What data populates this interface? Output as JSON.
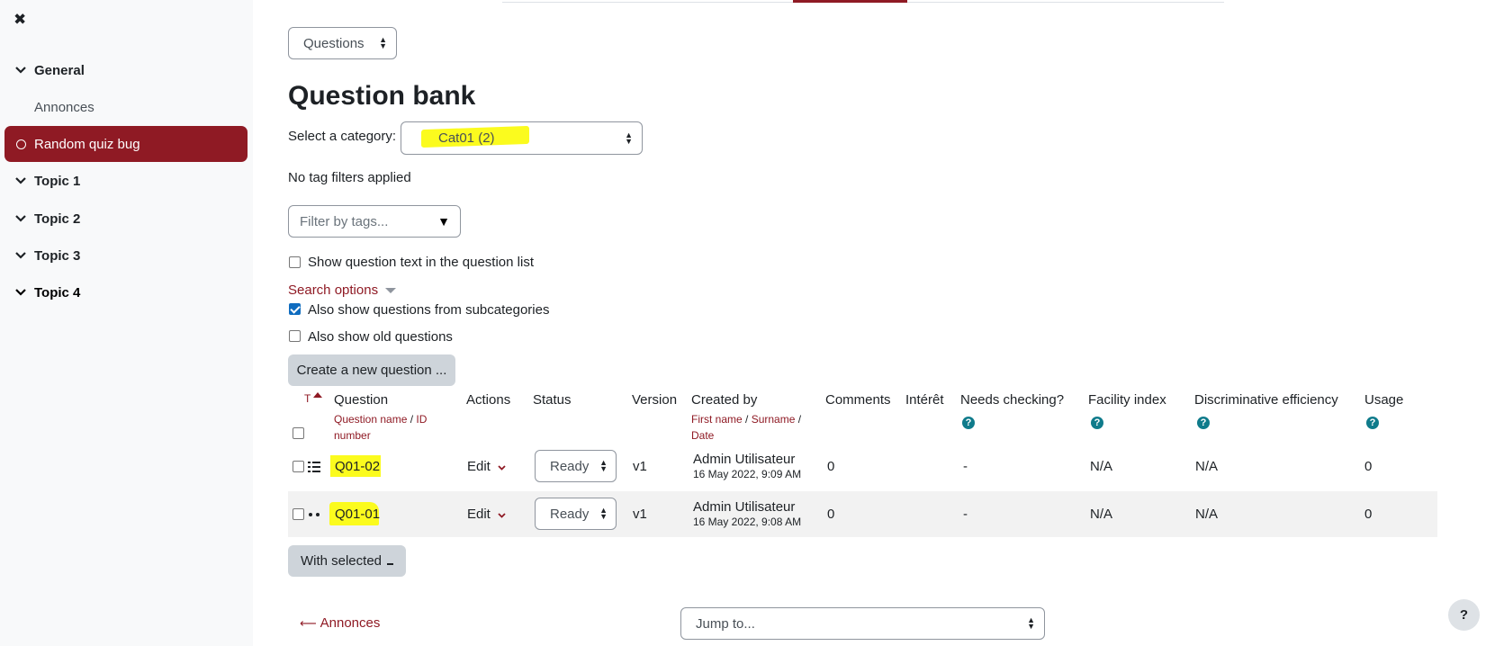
{
  "sidebar": {
    "close_glyph": "✖",
    "items": [
      {
        "label": "General",
        "kind": "section"
      },
      {
        "label": "Annonces",
        "kind": "plain"
      },
      {
        "label": "Random quiz bug",
        "kind": "active"
      },
      {
        "label": "Topic 1",
        "kind": "section"
      },
      {
        "label": "Topic 2",
        "kind": "section"
      },
      {
        "label": "Topic 3",
        "kind": "section"
      },
      {
        "label": "Topic 4",
        "kind": "section"
      }
    ]
  },
  "nav_select": {
    "value": "Questions"
  },
  "page_title": "Question bank",
  "category": {
    "label": "Select a category:",
    "value": "Cat01 (2)"
  },
  "tag_filters_text": "No tag filters applied",
  "tag_filter": {
    "placeholder": "Filter by tags..."
  },
  "options": {
    "show_question_text": "Show question text in the question list",
    "search_options": "Search options",
    "subcategories": "Also show questions from subcategories",
    "old_questions": "Also show old questions"
  },
  "create_button": "Create a new question ...",
  "table": {
    "headers": {
      "type": "T",
      "question": "Question",
      "question_sub": [
        "Question name",
        "ID number"
      ],
      "actions": "Actions",
      "status": "Status",
      "version": "Version",
      "created_by": "Created by",
      "created_sub": [
        "First name",
        "Surname",
        "Date"
      ],
      "comments": "Comments",
      "interet": "Intérêt",
      "needs_checking": "Needs checking?",
      "facility": "Facility index",
      "discriminative": "Discriminative efficiency",
      "usage": "Usage"
    },
    "rows": [
      {
        "name": "Q01-02",
        "action": "Edit",
        "status": "Ready",
        "version": "v1",
        "creator": "Admin Utilisateur",
        "date": "16 May 2022, 9:09 AM",
        "comments": "0",
        "needs_checking": "-",
        "facility": "N/A",
        "discriminative": "N/A",
        "usage": "0"
      },
      {
        "name": "Q01-01",
        "action": "Edit",
        "status": "Ready",
        "version": "v1",
        "creator": "Admin Utilisateur",
        "date": "16 May 2022, 9:08 AM",
        "comments": "0",
        "needs_checking": "-",
        "facility": "N/A",
        "discriminative": "N/A",
        "usage": "0"
      }
    ]
  },
  "with_selected": "With selected",
  "footer": {
    "prev_link": "Annonces",
    "jump_to": "Jump to..."
  },
  "help_fab": "?",
  "colors": {
    "brand": "#8f1a24",
    "info": "#0f7b8b",
    "highlight": "#fbfb1e"
  }
}
